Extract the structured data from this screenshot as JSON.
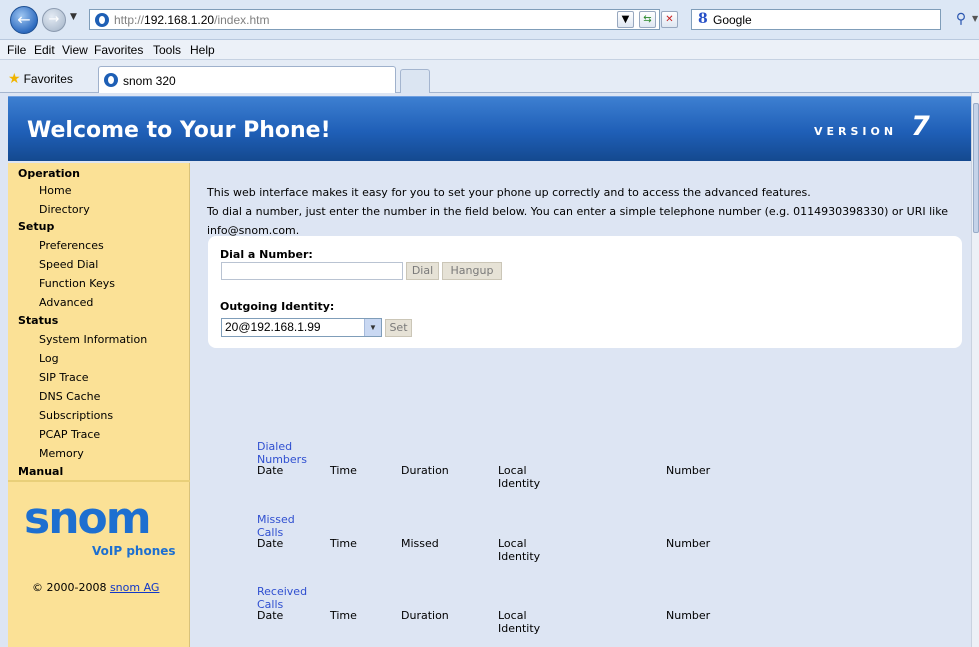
{
  "browser": {
    "url_host": "192.168.1.20",
    "url_prefix": "http://",
    "url_path": "/index.htm",
    "search_engine": "Google",
    "menu": [
      "File",
      "Edit",
      "View",
      "Favorites",
      "Tools",
      "Help"
    ],
    "favorites_label": "Favorites",
    "tab_title": "snom 320"
  },
  "banner": {
    "title": "Welcome to Your Phone!",
    "version_label": "VERSION",
    "version_number": "7"
  },
  "sidebar": {
    "sections": [
      {
        "label": "Operation",
        "items": [
          "Home",
          "Directory"
        ]
      },
      {
        "label": "Setup",
        "items": [
          "Preferences",
          "Speed Dial",
          "Function Keys",
          "Advanced"
        ]
      },
      {
        "label": "Status",
        "items": [
          "System Information",
          "Log",
          "SIP Trace",
          "DNS Cache",
          "Subscriptions",
          "PCAP Trace",
          "Memory"
        ]
      },
      {
        "label": "Manual",
        "items": []
      }
    ],
    "logo_word": "snom",
    "logo_sub": "VoIP phones",
    "copyright": "© 2000-2008 ",
    "copyright_link": "snom AG"
  },
  "intro": {
    "line1": "This web interface makes it easy for you to set your phone up correctly and to access the advanced features.",
    "line2": "To dial a number, just enter the number in the field below. You can enter a simple telephone number (e.g. 0114930398330) or URI like info@snom.com."
  },
  "dial": {
    "header": "Dial a Number:",
    "value": "",
    "dial_label": "Dial",
    "hangup_label": "Hangup",
    "identity_header": "Outgoing Identity:",
    "identity_value": "20@192.168.1.99",
    "set_label": "Set"
  },
  "call_lists": [
    {
      "title": "Dialed Numbers",
      "columns": [
        "Date",
        "Time",
        "Duration",
        "Local Identity",
        "Number"
      ]
    },
    {
      "title": "Missed Calls",
      "columns": [
        "Date",
        "Time",
        "Missed",
        "Local Identity",
        "Number"
      ]
    },
    {
      "title": "Received Calls",
      "columns": [
        "Date",
        "Time",
        "Duration",
        "Local Identity",
        "Number"
      ]
    }
  ],
  "colors": {
    "banner_blue": "#1f5fb7",
    "sidebar_yellow": "#fbe196",
    "page_bg": "#dde5f3",
    "link_blue": "#2f4fd0"
  }
}
